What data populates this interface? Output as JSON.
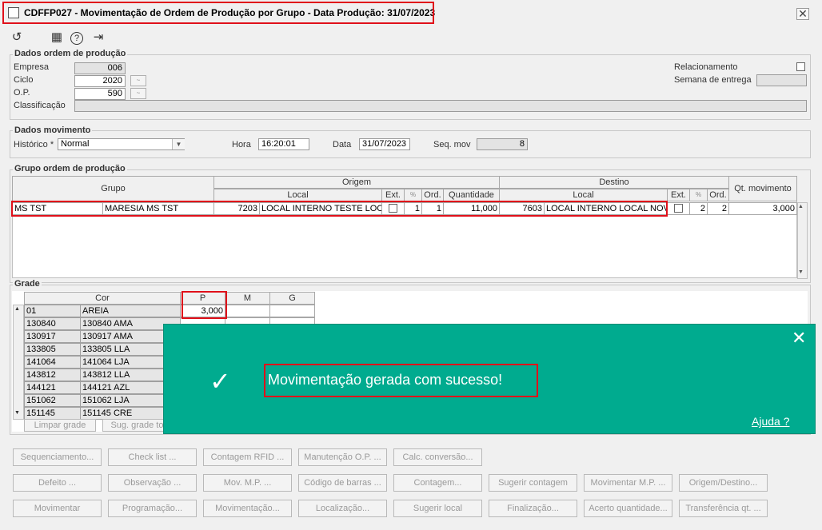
{
  "window": {
    "title": "CDFFP027 - Movimentação de Ordem de Produção por Grupo - Data Produção: 31/07/2023",
    "close": "✕"
  },
  "toolbar": {
    "undo": "↺",
    "calendar": "▦",
    "help": "?",
    "exit": "⇥"
  },
  "dados_op": {
    "title": "Dados ordem de produção",
    "empresa_label": "Empresa",
    "empresa_value": "006",
    "ciclo_label": "Ciclo",
    "ciclo_value": "2020",
    "op_label": "O.P.",
    "op_value": "590",
    "classificacao_label": "Classificação",
    "classificacao_value": "",
    "relacionamento_label": "Relacionamento",
    "semana_label": "Semana de entrega",
    "semana_value": ""
  },
  "dados_mov": {
    "title": "Dados movimento",
    "historico_label": "Histórico *",
    "historico_value": "Normal",
    "hora_label": "Hora",
    "hora_value": "16:20:01",
    "data_label": "Data",
    "data_value": "31/07/2023",
    "seq_label": "Seq. mov",
    "seq_value": "8"
  },
  "grupo_op": {
    "title": "Grupo ordem de produção",
    "headers": {
      "grupo": "Grupo",
      "origem": "Origem",
      "destino": "Destino",
      "qt_mov": "Qt. movimento",
      "local": "Local",
      "ext": "Ext.",
      "ord": "Ord.",
      "quantidade": "Quantidade",
      "local2": "Local",
      "ext2": "Ext.",
      "ord2": "Ord.",
      "mark": "%",
      "mark2": "%"
    },
    "row": {
      "grupo_code": "MS TST",
      "grupo_desc": "MARESIA MS TST",
      "orig_local_code": "7203",
      "orig_local_desc": "LOCAL INTERNO TESTE LOCAL",
      "orig_n1": "1",
      "orig_ord": "1",
      "quantidade": "11,000",
      "dest_local_code": "7603",
      "dest_local_desc": "LOCAL INTERNO LOCAL NOVO",
      "dest_n1": "2",
      "dest_ord": "2",
      "qt_movimento": "3,000"
    }
  },
  "grade": {
    "title": "Grade",
    "headers": {
      "cor": "Cor",
      "p": "P",
      "m": "M",
      "g": "G"
    },
    "rows": [
      {
        "code": "01",
        "desc": "AREIA",
        "p": "3,000"
      },
      {
        "code": "130840",
        "desc": "130840 AMA",
        "p": ""
      },
      {
        "code": "130917",
        "desc": "130917 AMA",
        "p": ""
      },
      {
        "code": "133805",
        "desc": "133805 LLA",
        "p": ""
      },
      {
        "code": "141064",
        "desc": "141064 LJA",
        "p": ""
      },
      {
        "code": "143812",
        "desc": "143812 LLA",
        "p": ""
      },
      {
        "code": "144121",
        "desc": "144121 AZL",
        "p": ""
      },
      {
        "code": "151062",
        "desc": "151062 LJA",
        "p": ""
      },
      {
        "code": "151145",
        "desc": "151145 CRE",
        "p": ""
      }
    ],
    "limpar": "Limpar grade",
    "sug": "Sug. grade tot"
  },
  "buttons": {
    "row1": [
      "Sequenciamento...",
      "Check list ...",
      "Contagem RFID ...",
      "Manutenção O.P. ...",
      "Calc. conversão..."
    ],
    "row2": [
      "Defeito ...",
      "Observação ...",
      "Mov. M.P. ...",
      "Código de barras ...",
      "Contagem...",
      "Sugerir contagem",
      "Movimentar M.P. ...",
      "Origem/Destino..."
    ],
    "row3": [
      "Movimentar",
      "Programação...",
      "Movimentação...",
      "Localização...",
      "Sugerir local",
      "Finalização...",
      "Acerto quantidade...",
      "Transferência qt. ..."
    ]
  },
  "toast": {
    "message": "Movimentação gerada com sucesso!",
    "help": "Ajuda ?",
    "close": "✕",
    "check": "✓"
  }
}
